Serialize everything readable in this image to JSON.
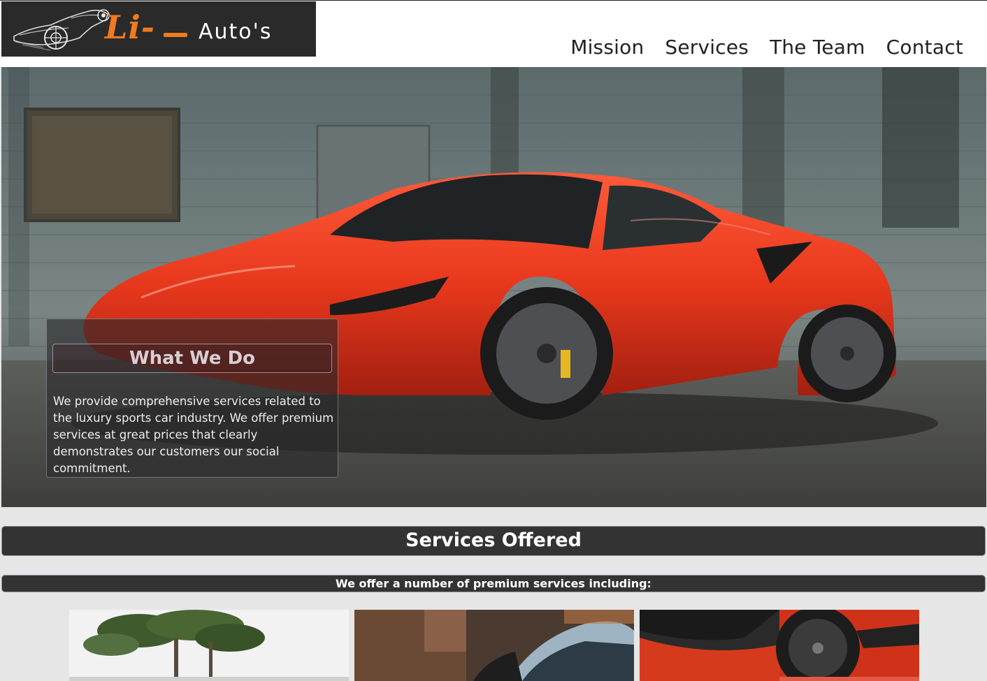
{
  "header": {
    "logo": {
      "primary": "Li-",
      "secondary": "Auto's"
    },
    "nav": [
      {
        "label": "Mission"
      },
      {
        "label": "Services"
      },
      {
        "label": "The Team"
      },
      {
        "label": "Contact"
      }
    ]
  },
  "hero": {
    "image": "red-sports-car-photo",
    "box_title": "What We Do",
    "box_text": "We provide comprehensive services related to the luxury sports car industry. We offer premium services at great prices that clearly demonstrates our customers our social commitment."
  },
  "services": {
    "heading": "Services Offered",
    "subheading": "We offer a number of premium services including:",
    "thumbnails": [
      {
        "image": "tree-photo"
      },
      {
        "image": "car-closeup-photo"
      },
      {
        "image": "red-car-side-photo"
      }
    ]
  },
  "colors": {
    "accent": "#f07a1e",
    "bar_background": "#333333",
    "page_background": "#e6e6e6"
  }
}
